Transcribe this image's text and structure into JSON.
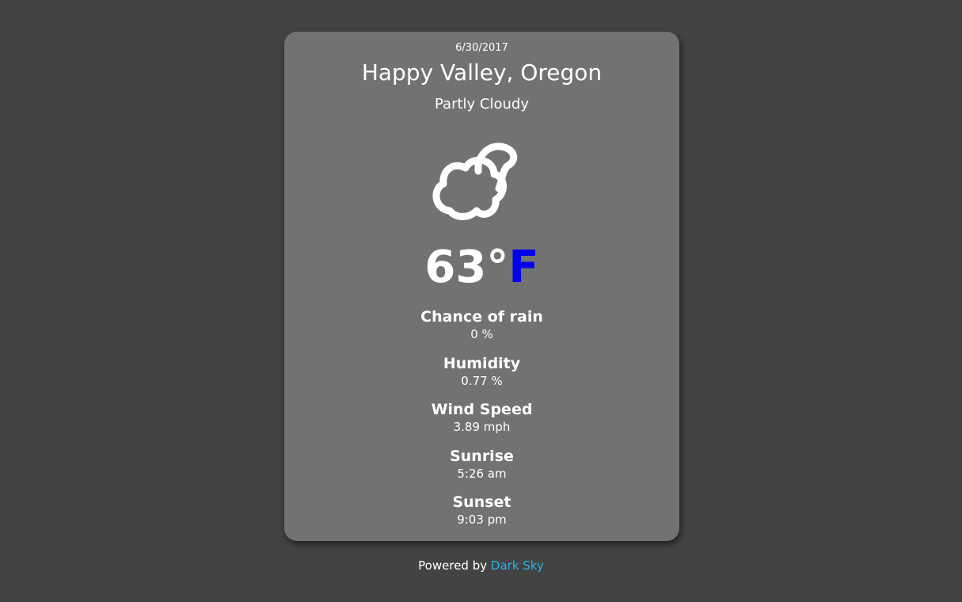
{
  "weather": {
    "date": "6/30/2017",
    "location": "Happy Valley, Oregon",
    "summary": "Partly Cloudy",
    "icon": "partly-cloudy-icon",
    "temperature": "63°",
    "unit": "F",
    "unit_color": "#0000ee"
  },
  "stats": [
    {
      "label": "Chance of rain",
      "value": "0 %"
    },
    {
      "label": "Humidity",
      "value": "0.77 %"
    },
    {
      "label": "Wind Speed",
      "value": "3.89 mph"
    },
    {
      "label": "Sunrise",
      "value": "5:26 am"
    },
    {
      "label": "Sunset",
      "value": "9:03 pm"
    }
  ],
  "footer": {
    "prefix": "Powered by",
    "link_text": "Dark Sky",
    "link_color": "#2bb0e6"
  },
  "colors": {
    "background": "#434343",
    "card": "#727272"
  }
}
